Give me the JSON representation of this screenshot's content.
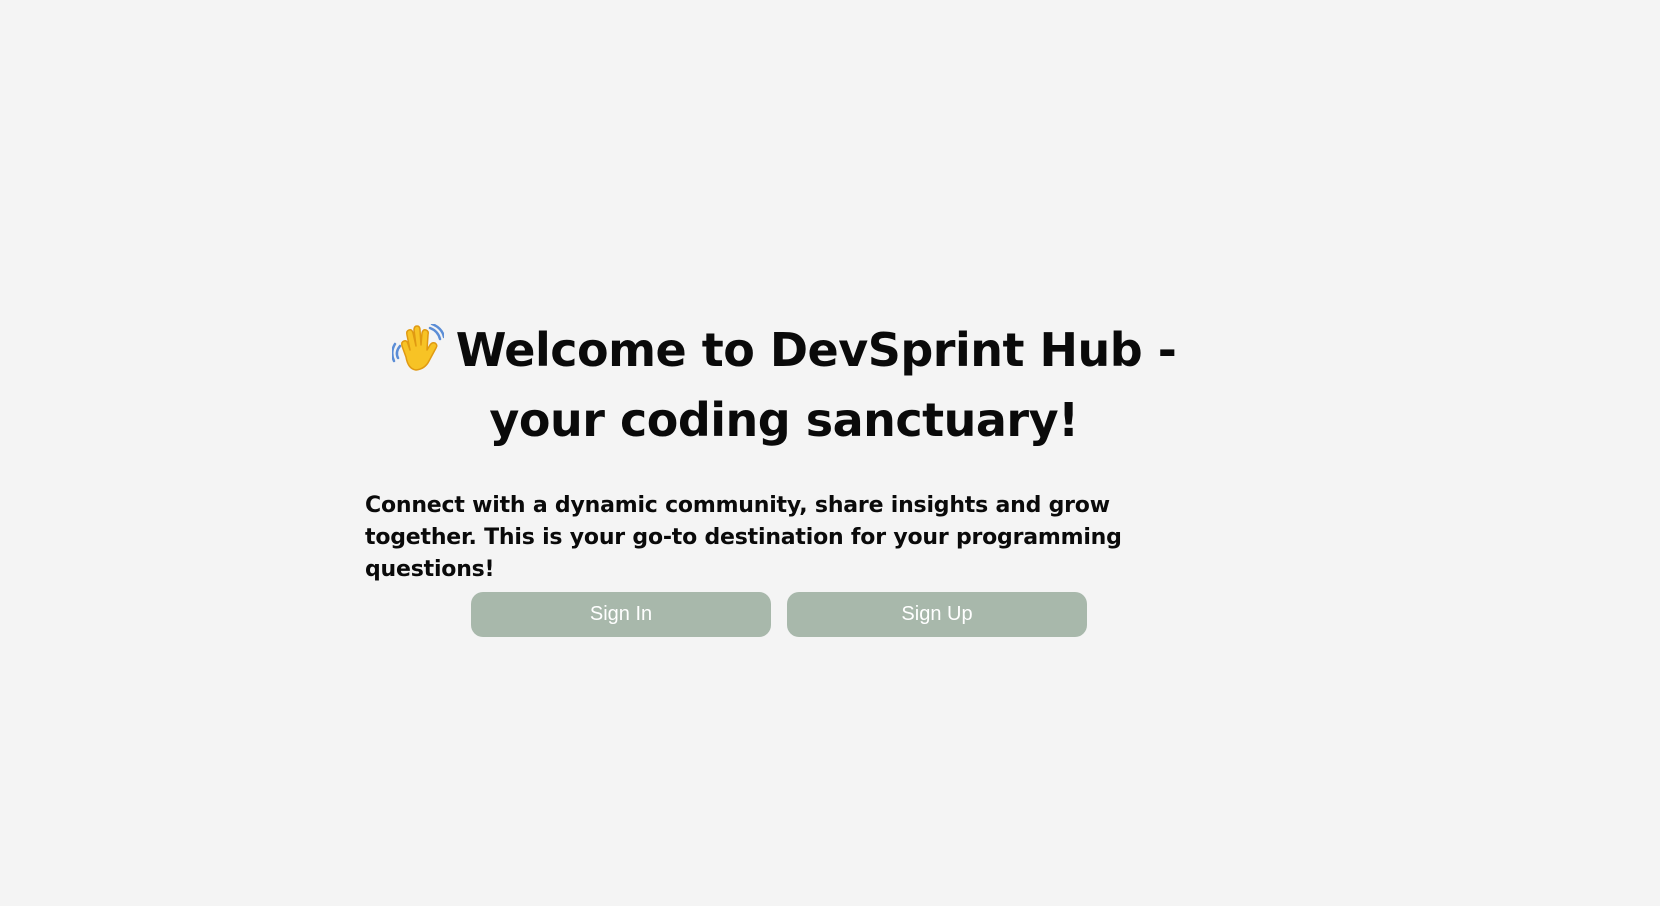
{
  "hero": {
    "wave_icon": "waving-hand-icon",
    "title": "Welcome to DevSprint Hub - your coding sanctuary!",
    "subtitle": "Connect with a dynamic community, share insights and grow together. This is your go-to destination for your programming questions!"
  },
  "actions": {
    "sign_in_label": "Sign In",
    "sign_up_label": "Sign Up"
  },
  "colors": {
    "background": "#f4f4f4",
    "button": "#a8b8ab",
    "button_text": "#ffffff",
    "text": "#0a0a0a"
  }
}
